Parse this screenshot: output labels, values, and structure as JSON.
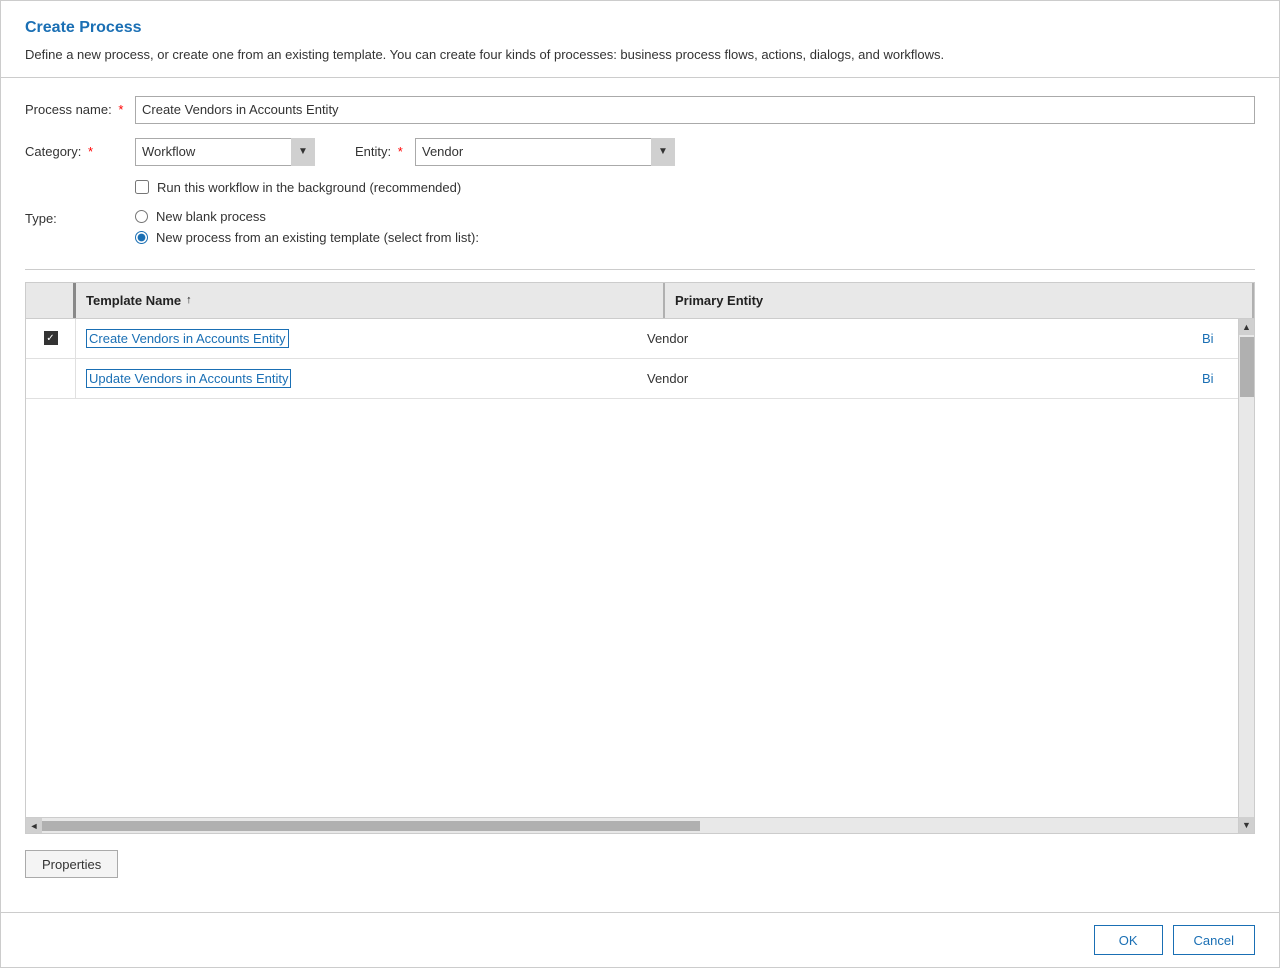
{
  "dialog": {
    "title": "Create Process",
    "description": "Define a new process, or create one from an existing template. You can create four kinds of processes: business process flows, actions, dialogs, and workflows.",
    "fields": {
      "process_name_label": "Process name:",
      "process_name_value": "Create Vendors in Accounts Entity",
      "category_label": "Category:",
      "category_value": "Workflow",
      "entity_label": "Entity:",
      "entity_value": "Vendor",
      "background_checkbox_label": "Run this workflow in the background (recommended)",
      "type_label": "Type:",
      "type_option1": "New blank process",
      "type_option2": "New process from an existing template (select from list):"
    },
    "table": {
      "col1_header": "Template Name",
      "col2_header": "Primary Entity",
      "sort_indicator": "↑",
      "rows": [
        {
          "checked": true,
          "template_name": "Create Vendors in Accounts Entity",
          "primary_entity": "Vendor",
          "extra": "Bi"
        },
        {
          "checked": false,
          "template_name": "Update Vendors in Accounts Entity",
          "primary_entity": "Vendor",
          "extra": "Bi"
        }
      ]
    },
    "buttons": {
      "properties": "Properties",
      "ok": "OK",
      "cancel": "Cancel"
    },
    "required_star": "*"
  }
}
